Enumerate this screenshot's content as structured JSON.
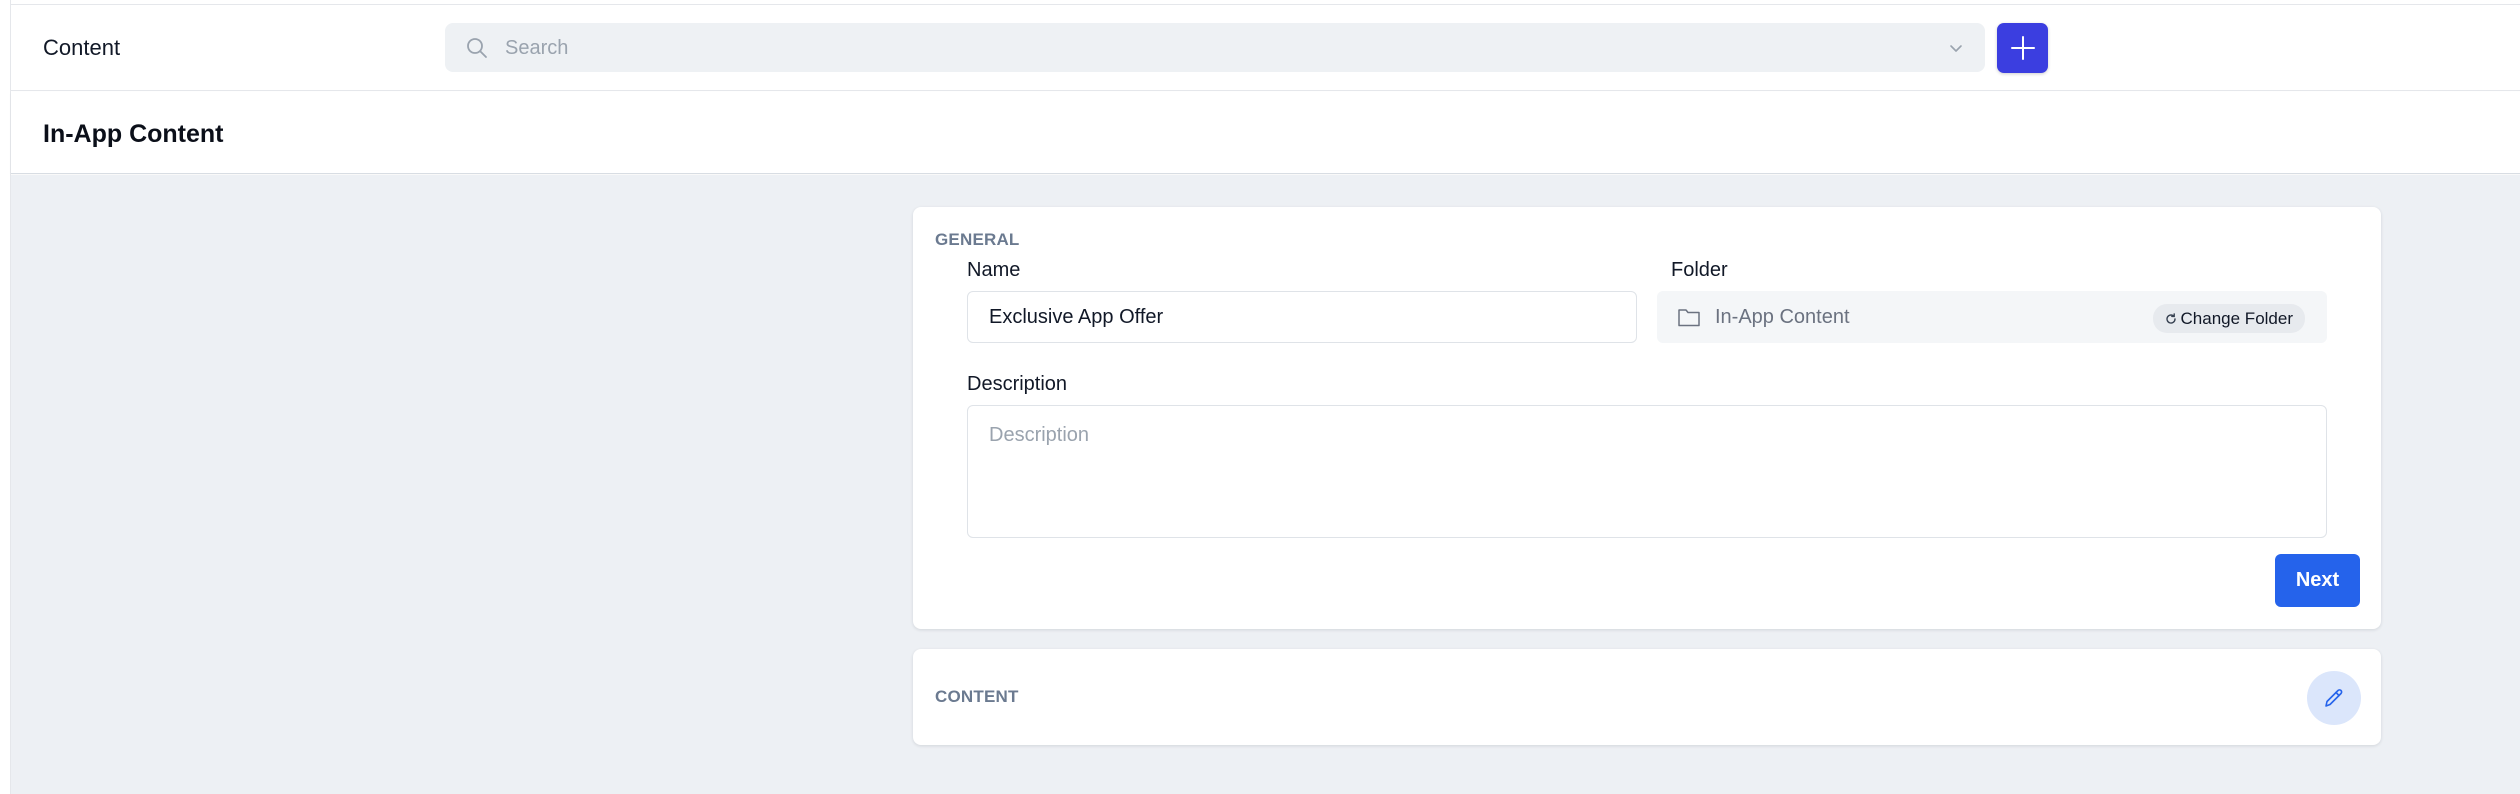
{
  "header": {
    "title": "Content",
    "search_placeholder": "Search",
    "add_icon": "plus-icon"
  },
  "page": {
    "title": "In-App Content"
  },
  "general": {
    "section_label": "GENERAL",
    "name_label": "Name",
    "name_value": "Exclusive App Offer",
    "folder_label": "Folder",
    "folder_value": "In-App Content",
    "change_folder_label": "Change Folder",
    "description_label": "Description",
    "description_placeholder": "Description",
    "next_label": "Next"
  },
  "content": {
    "section_label": "CONTENT",
    "edit_icon": "pencil-icon"
  },
  "colors": {
    "accent": "#3b3ee0",
    "primary_button": "#2563eb",
    "background": "#edf0f4"
  }
}
